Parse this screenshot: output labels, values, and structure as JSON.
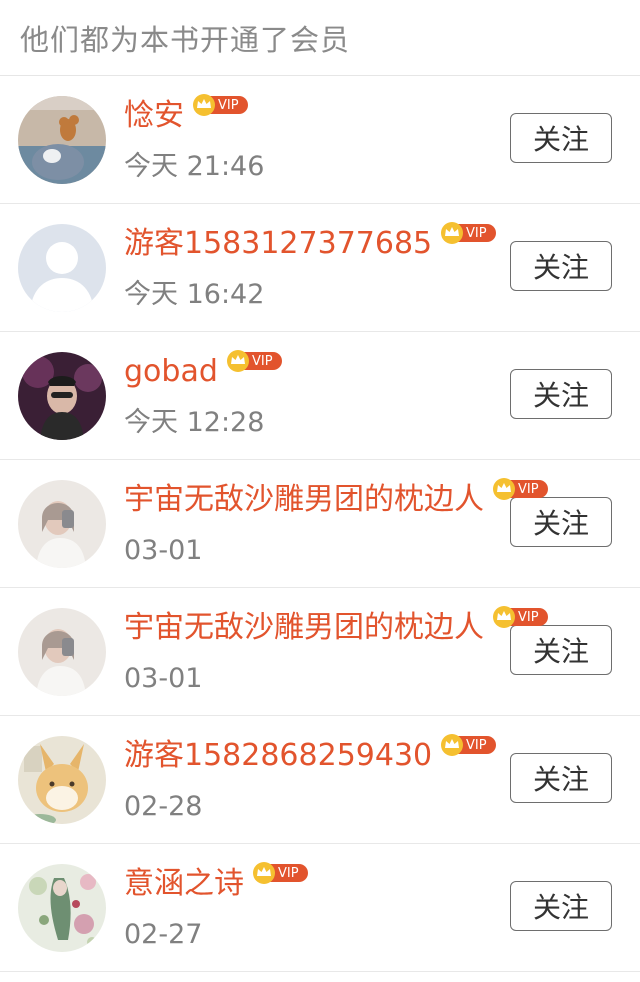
{
  "header": {
    "title": "他们都为本书开通了会员"
  },
  "badge": {
    "label": "VIP",
    "color": "#e2542d",
    "crown_color": "#f5c030"
  },
  "members": [
    {
      "name": "惗安",
      "time": "今天 21:46",
      "avatar_icon": "cartoon-cat-mouse-avatar",
      "follow_label": "关注"
    },
    {
      "name": "游客1583127377685",
      "time": "今天 16:42",
      "avatar_icon": "default-user-avatar",
      "follow_label": "关注"
    },
    {
      "name": "gobad",
      "time": "今天 12:28",
      "avatar_icon": "photo-avatar",
      "follow_label": "关注"
    },
    {
      "name": "宇宙无敌沙雕男团的枕边人",
      "time": "03-01",
      "avatar_icon": "selfie-avatar",
      "follow_label": "关注"
    },
    {
      "name": "宇宙无敌沙雕男团的枕边人",
      "time": "03-01",
      "avatar_icon": "selfie-avatar",
      "follow_label": "关注"
    },
    {
      "name": "游客1582868259430",
      "time": "02-28",
      "avatar_icon": "cartoon-rabbit-avatar",
      "follow_label": "关注"
    },
    {
      "name": "意涵之诗",
      "time": "02-27",
      "avatar_icon": "floral-art-avatar",
      "follow_label": "关注"
    }
  ]
}
